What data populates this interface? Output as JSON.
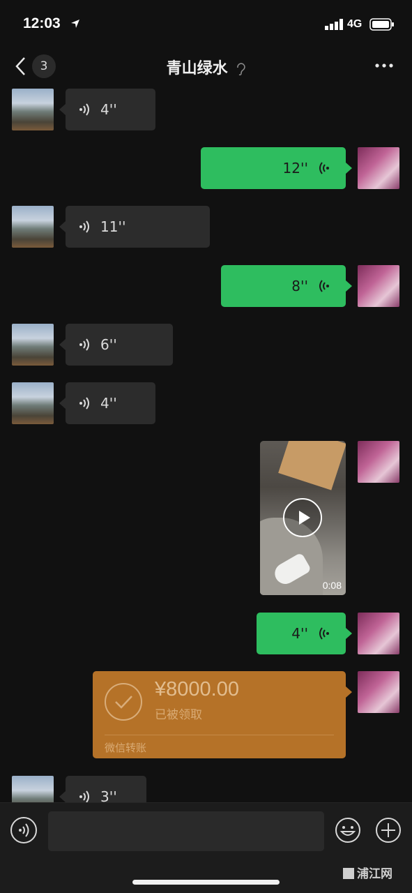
{
  "status_bar": {
    "time": "12:03",
    "network": "4G"
  },
  "nav": {
    "unread_count": "3",
    "title": "青山绿水"
  },
  "messages": [
    {
      "side": "left",
      "duration": "4''"
    },
    {
      "side": "right",
      "duration": "12''"
    },
    {
      "side": "left",
      "duration": "11''"
    },
    {
      "side": "right",
      "duration": "8''"
    },
    {
      "side": "left",
      "duration": "6''"
    },
    {
      "side": "left",
      "duration": "4''"
    },
    {
      "side": "right",
      "type": "video",
      "duration": "0:08"
    },
    {
      "side": "right",
      "duration": "4''"
    },
    {
      "side": "right",
      "type": "transfer",
      "amount": "¥8000.00",
      "status": "已被领取",
      "label": "微信转账"
    },
    {
      "side": "left",
      "duration": "3''"
    }
  ],
  "input": {
    "placeholder": ""
  },
  "watermark": "浦江网",
  "colors": {
    "bubble_sent": "#2ebd5f",
    "bubble_received": "#2c2c2c",
    "transfer": "#b57228",
    "background": "#111111"
  },
  "icons": [
    "back-icon",
    "ear-icon",
    "more-icon",
    "voice-wave-icon",
    "play-icon",
    "check-icon",
    "voice-input-icon",
    "emoji-icon",
    "plus-icon"
  ]
}
